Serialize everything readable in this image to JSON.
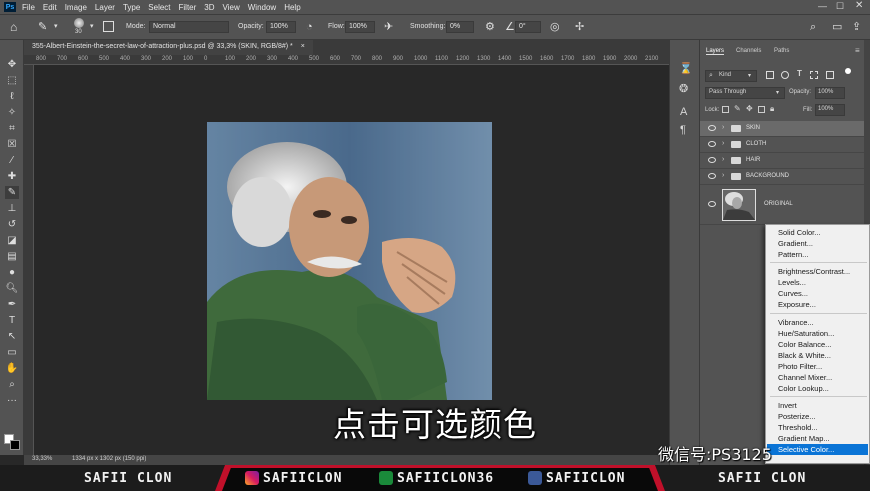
{
  "menubar": {
    "logo": "Ps",
    "items": [
      "File",
      "Edit",
      "Image",
      "Layer",
      "Type",
      "Select",
      "Filter",
      "3D",
      "View",
      "Window",
      "Help"
    ]
  },
  "options": {
    "brush_size": "30",
    "mode_label": "Mode:",
    "mode_value": "Normal",
    "opacity_label": "Opacity:",
    "opacity_value": "100%",
    "flow_label": "Flow:",
    "flow_value": "100%",
    "smoothing_label": "Smoothing:",
    "smoothing_value": "0%",
    "angle_value": "0°"
  },
  "document": {
    "tab_title": "355-Albert-Einstein-the-secret-law-of-attraction-plus.psd @ 33,3% (SKIN, RGB/8#) *",
    "zoom": "33,33%",
    "doc_info": "1334 px x 1302 px (150 ppi)"
  },
  "ruler_ticks": [
    "800",
    "700",
    "600",
    "500",
    "400",
    "300",
    "200",
    "100",
    "0",
    "100",
    "200",
    "300",
    "400",
    "500",
    "600",
    "700",
    "800",
    "900",
    "1000",
    "1100",
    "1200",
    "1300",
    "1400",
    "1500",
    "1600",
    "1700",
    "1800",
    "1900",
    "2000",
    "2100"
  ],
  "layers_panel": {
    "tabs": [
      "Layers",
      "Channels",
      "Paths"
    ],
    "kind_label": "Kind",
    "blend_mode": "Pass Through",
    "opacity_label": "Opacity:",
    "opacity_value": "100%",
    "lock_label": "Lock:",
    "fill_label": "Fill:",
    "fill_value": "100%",
    "layers": [
      {
        "name": "SKIN",
        "type": "group",
        "selected": true
      },
      {
        "name": "CLOTH",
        "type": "group",
        "selected": false
      },
      {
        "name": "HAIR",
        "type": "group",
        "selected": false
      },
      {
        "name": "BACKGROUND",
        "type": "group",
        "selected": false
      },
      {
        "name": "ORIGINAL",
        "type": "image",
        "selected": false
      }
    ]
  },
  "adjustment_menu": {
    "group1": [
      "Solid Color...",
      "Gradient...",
      "Pattern..."
    ],
    "group2": [
      "Brightness/Contrast...",
      "Levels...",
      "Curves...",
      "Exposure..."
    ],
    "group3": [
      "Vibrance...",
      "Hue/Saturation...",
      "Color Balance...",
      "Black & White...",
      "Photo Filter...",
      "Channel Mixer...",
      "Color Lookup..."
    ],
    "group4": [
      "Invert",
      "Posterize...",
      "Threshold...",
      "Gradient Map...",
      "Selective Color..."
    ],
    "highlighted": "Selective Color..."
  },
  "overlay": {
    "subtitle": "点击可选颜色",
    "wechat": "微信号:PS3125"
  },
  "footer": {
    "name_left": "SAFII CLON",
    "instagram": "SAFIICLON",
    "xing": "SAFIICLON36",
    "facebook": "SAFIICLON",
    "name_right": "SAFII CLON"
  },
  "colors": {
    "ui_panel": "#535353",
    "canvas_bg": "#282828",
    "menu_highlight": "#0a74d6",
    "footer_accent": "#c0102a"
  }
}
